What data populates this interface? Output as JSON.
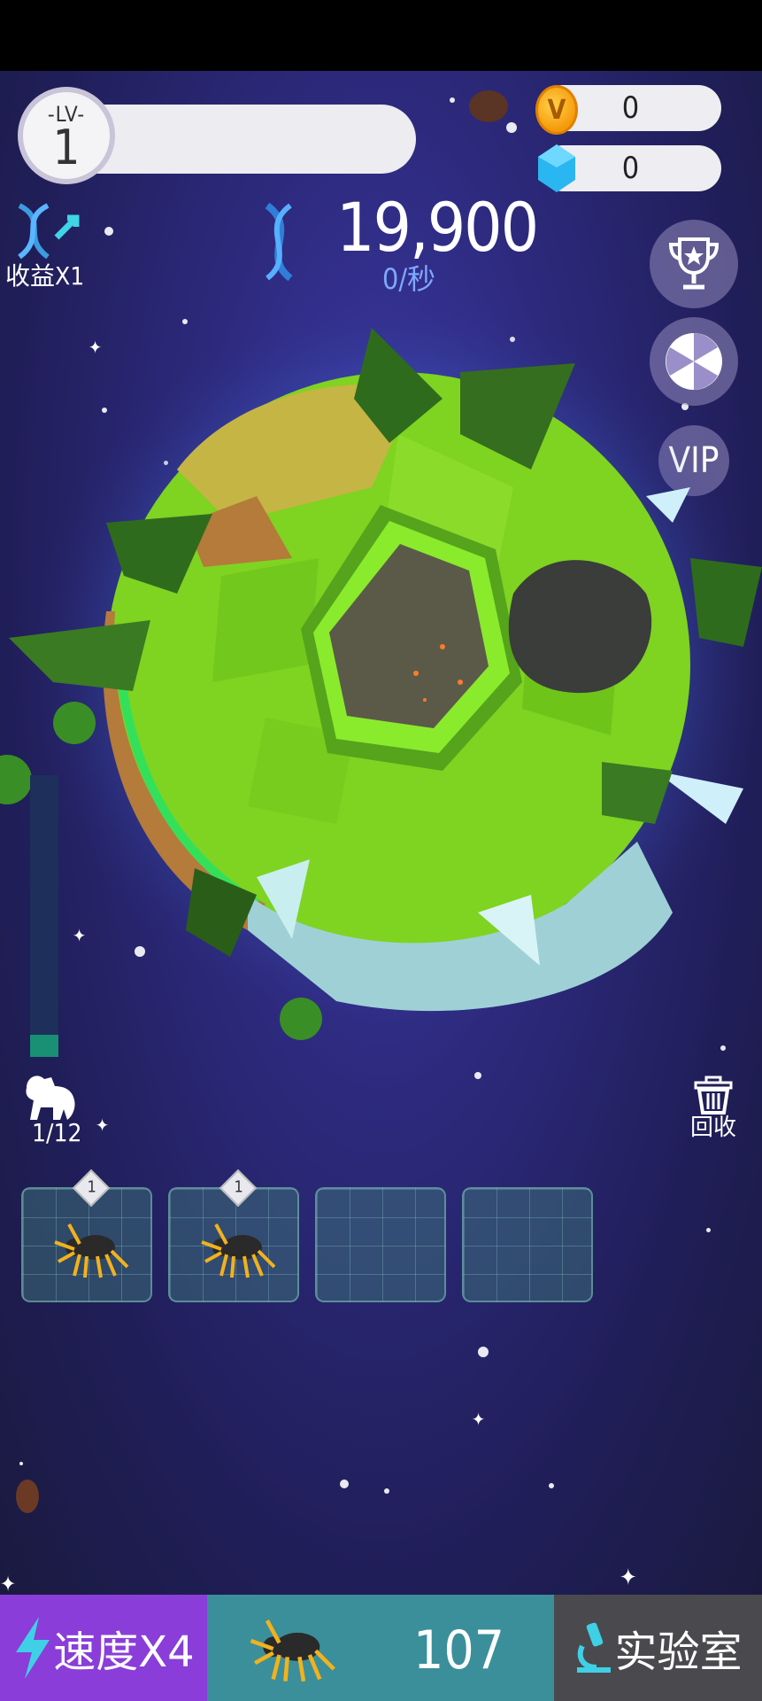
{
  "level": {
    "label": "-LV-",
    "value": "1"
  },
  "resources": {
    "coins": "0",
    "gems": "0"
  },
  "income": {
    "label": "收益X1"
  },
  "dna": {
    "count": "19,900",
    "rate": "0/秒"
  },
  "side_buttons": {
    "vip_label": "VIP"
  },
  "pets": {
    "count": "1/12",
    "progress": 0.08
  },
  "recycle": {
    "label": "回收"
  },
  "slots": [
    {
      "badge": "1",
      "filled": true
    },
    {
      "badge": "1",
      "filled": true
    },
    {
      "badge": "",
      "filled": false
    },
    {
      "badge": "",
      "filled": false
    }
  ],
  "bottom": {
    "speed_label": "速度X4",
    "buy_cost": "107",
    "lab_label": "实验室"
  },
  "colors": {
    "speed": "#8a3dd9",
    "buy": "#3a8f9a",
    "lab": "#4a4a4e",
    "planet_green": "#7fd321",
    "background": "#2d2a7e"
  },
  "icons": [
    "coin-icon",
    "gem-icon",
    "dna-icon",
    "trophy-icon",
    "wheel-icon",
    "dog-icon",
    "trash-icon",
    "spider-icon",
    "lightning-icon",
    "microscope-icon"
  ]
}
